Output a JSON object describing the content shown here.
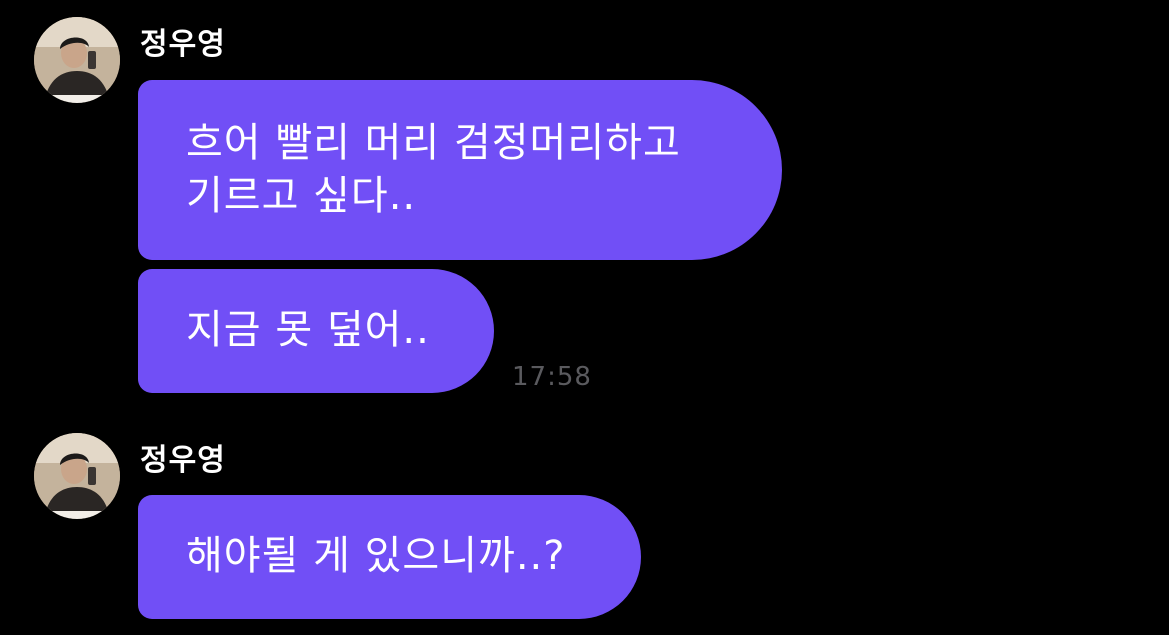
{
  "theme": {
    "background": "#000000",
    "bubble_color": "#714ff6",
    "text_color": "#ffffff",
    "timestamp_color": "#5a5a5e"
  },
  "messages": [
    {
      "sender": "정우영",
      "avatar_icon": "profile-photo-icon",
      "bubbles": [
        {
          "lines": [
            "흐어 빨리 머리 검정머리하고",
            "기르고 싶다.."
          ]
        },
        {
          "lines": [
            "지금 못 덮어.."
          ]
        }
      ],
      "timestamp": "17:58"
    },
    {
      "sender": "정우영",
      "avatar_icon": "profile-photo-icon",
      "bubbles": [
        {
          "lines": [
            "해야될 게 있으니까..?"
          ]
        }
      ]
    }
  ]
}
